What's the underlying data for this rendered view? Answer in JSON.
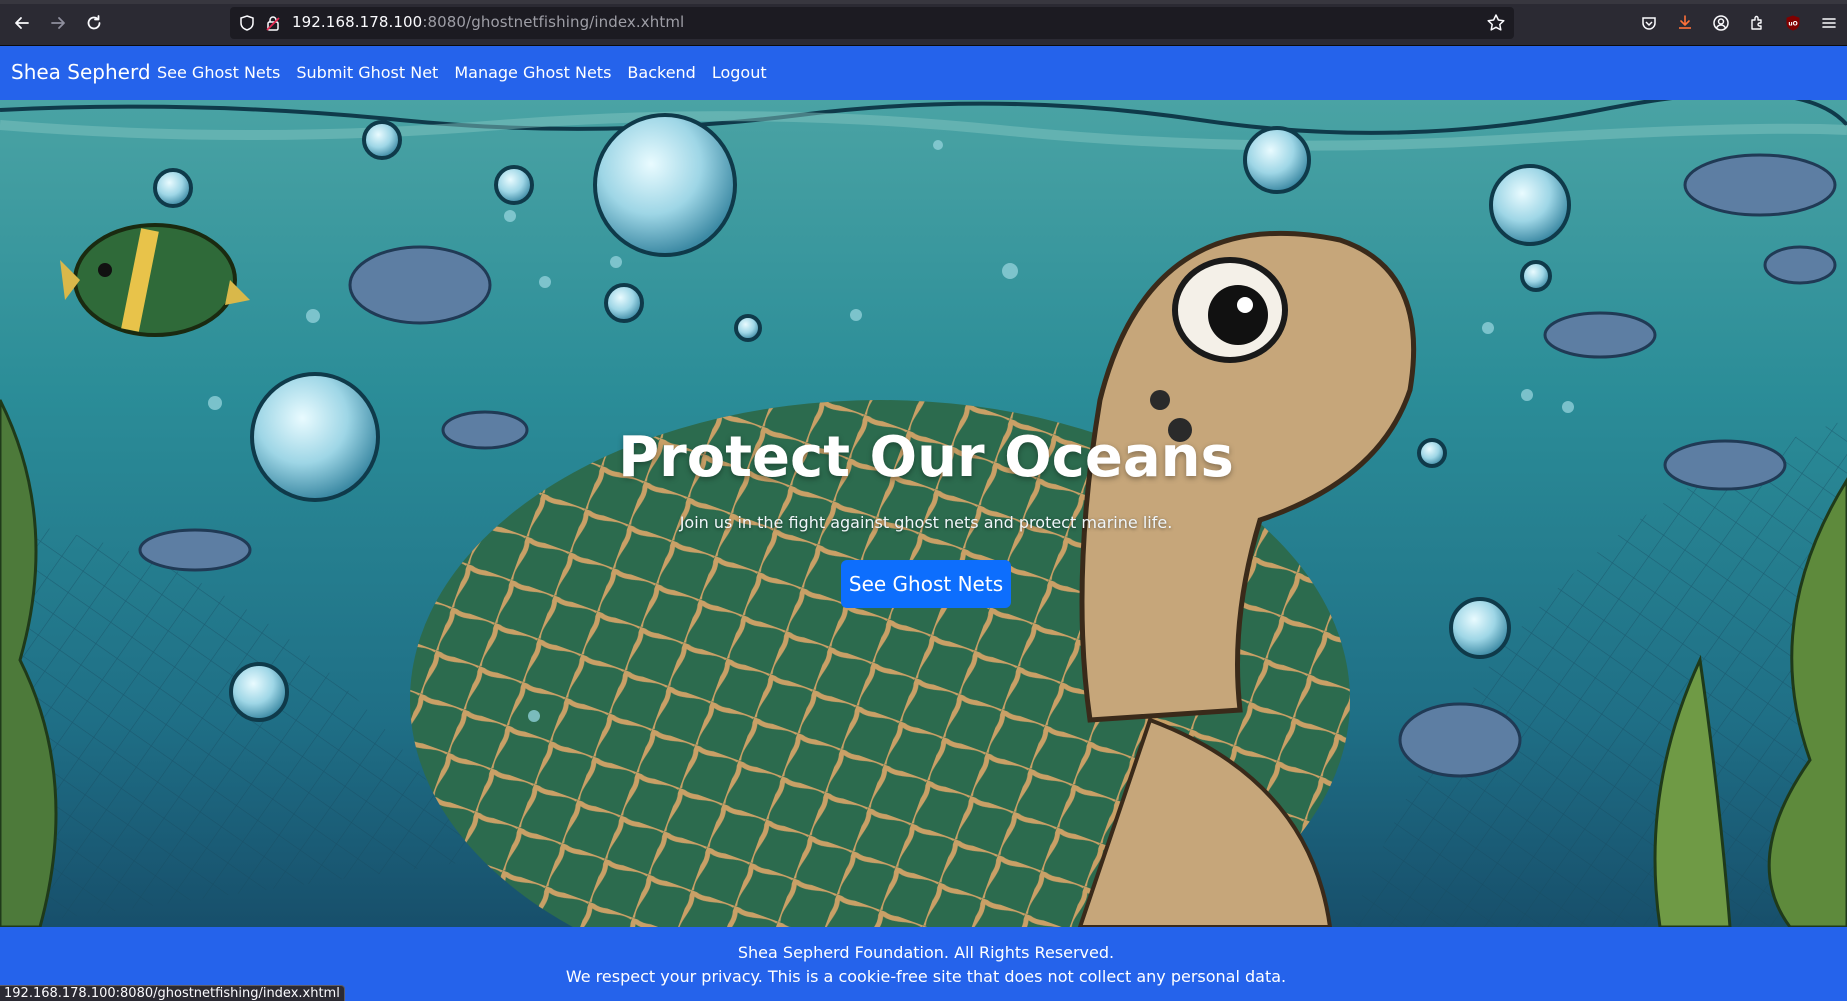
{
  "browser": {
    "url_host": "192.168.178.100",
    "url_rest": ":8080/ghostnetfishing/index.xhtml",
    "status_url": "192.168.178.100:8080/ghostnetfishing/index.xhtml",
    "icons": [
      "back-icon",
      "forward-icon",
      "reload-icon",
      "shield-icon",
      "lock-icon",
      "bookmark-star-icon",
      "pocket-icon",
      "download-icon",
      "account-icon",
      "extensions-icon",
      "ublock-icon",
      "menu-icon"
    ]
  },
  "navbar": {
    "brand": "Shea Sepherd",
    "links": [
      {
        "label": "See Ghost Nets"
      },
      {
        "label": "Submit Ghost Net"
      },
      {
        "label": "Manage Ghost Nets"
      },
      {
        "label": "Backend"
      },
      {
        "label": "Logout"
      }
    ],
    "color": "#2563eb"
  },
  "hero": {
    "title": "Protect Our Oceans",
    "subtitle": "Join us in the fight against ghost nets and protect marine life.",
    "button_label": "See Ghost Nets",
    "button_color": "#0d6efd"
  },
  "footer": {
    "line1": "Shea Sepherd Foundation. All Rights Reserved.",
    "line2": "We respect your privacy. This is a cookie-free site that does not collect any personal data."
  }
}
